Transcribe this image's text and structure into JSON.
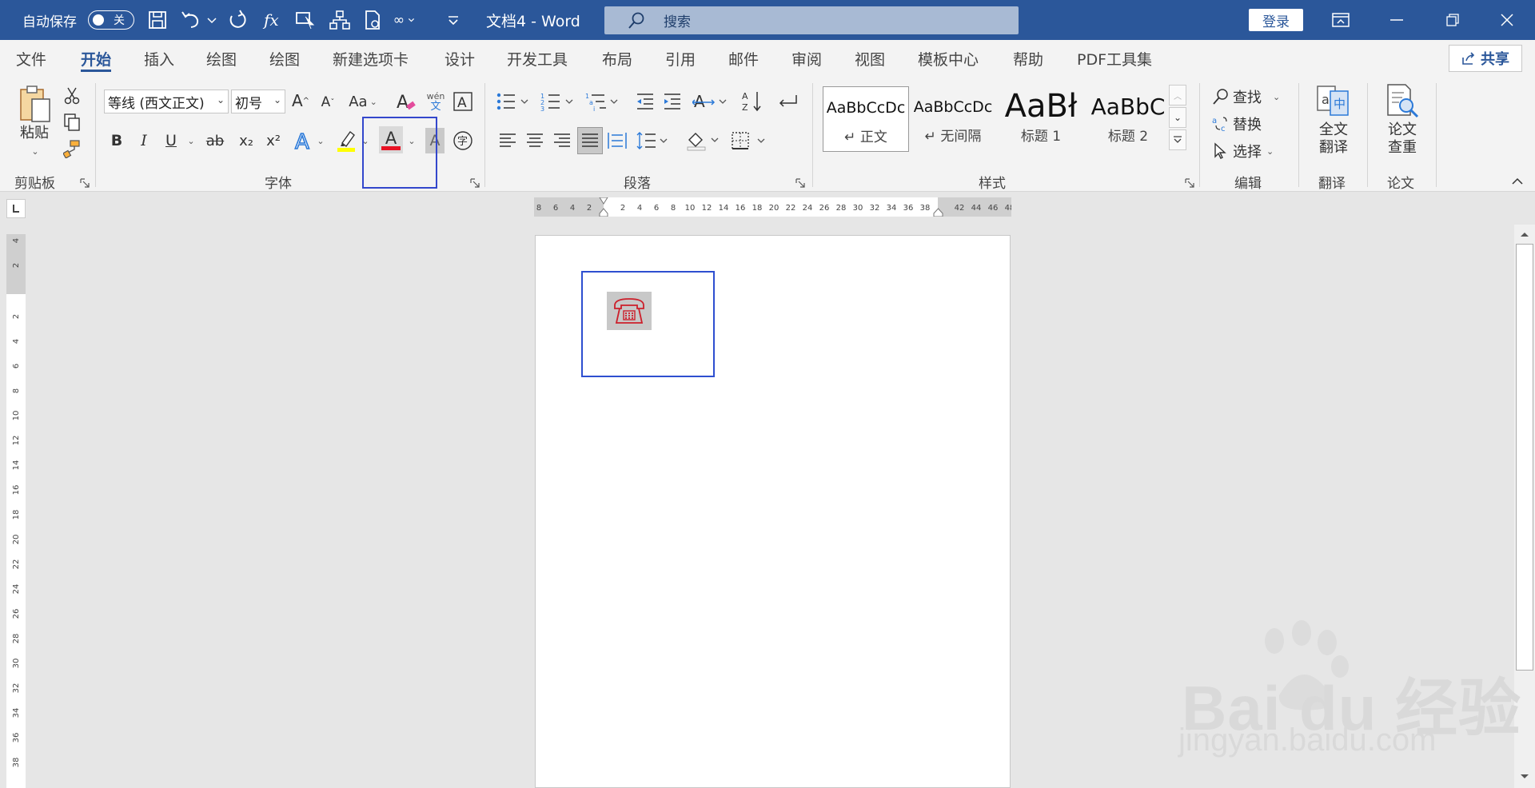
{
  "titlebar": {
    "autosave_label": "自动保存",
    "autosave_state": "关",
    "doc_title": "文档4  -  Word",
    "search_placeholder": "搜索",
    "login_label": "登录"
  },
  "menu": {
    "tabs": [
      "文件",
      "开始",
      "插入",
      "绘图",
      "绘图",
      "新建选项卡",
      "设计",
      "开发工具",
      "布局",
      "引用",
      "邮件",
      "审阅",
      "视图",
      "模板中心",
      "帮助",
      "PDF工具集"
    ],
    "active_tab": "开始",
    "share_label": "共享"
  },
  "ribbon": {
    "clipboard": {
      "group_label": "剪贴板",
      "paste_label": "粘贴"
    },
    "font": {
      "group_label": "字体",
      "font_name": "等线 (西文正文)",
      "font_size": "初号",
      "bold": "B",
      "italic": "I",
      "underline": "U",
      "strike": "ab",
      "subscript": "x₂",
      "superscript": "x²",
      "change_case": "Aa",
      "phonetic_top": "wén",
      "phonetic_bottom": "文",
      "font_color_letter": "A",
      "font_color": "#e81123",
      "highlight_color": "#ffff00"
    },
    "paragraph": {
      "group_label": "段落"
    },
    "styles": {
      "group_label": "样式",
      "items": [
        {
          "sample": "AaBbCcDc",
          "name": "↵ 正文"
        },
        {
          "sample": "AaBbCcDc",
          "name": "↵ 无间隔"
        },
        {
          "sample": "AaBł",
          "name": "标题 1"
        },
        {
          "sample": "AaBbC",
          "name": "标题 2"
        }
      ]
    },
    "editing": {
      "group_label": "编辑",
      "find": "查找",
      "replace": "替换",
      "select": "选择"
    },
    "translate": {
      "group_label": "翻译",
      "label_line1": "全文",
      "label_line2": "翻译"
    },
    "paper": {
      "group_label": "论文",
      "label_line1": "论文",
      "label_line2": "查重"
    }
  },
  "rulers": {
    "horizontal_left": [
      "8",
      "6",
      "4",
      "2"
    ],
    "horizontal_right": [
      "2",
      "4",
      "6",
      "8",
      "10",
      "12",
      "14",
      "16",
      "18",
      "20",
      "22",
      "24",
      "26",
      "28",
      "30",
      "32",
      "34",
      "36",
      "38"
    ],
    "horizontal_margin": [
      "42",
      "44",
      "46",
      "48"
    ],
    "vertical_top": [
      "4",
      "2"
    ],
    "vertical_body": [
      "2",
      "4",
      "6",
      "8",
      "10",
      "12",
      "14",
      "16",
      "18",
      "20",
      "22",
      "24",
      "26",
      "28",
      "30",
      "32",
      "34",
      "36",
      "38"
    ]
  },
  "document": {
    "symbol": "☎"
  },
  "watermark": {
    "brand": "Bai du 经验",
    "url": "jingyan.baidu.com"
  },
  "colors": {
    "accent": "#2b579a",
    "selection_box": "#2e4fd0"
  }
}
